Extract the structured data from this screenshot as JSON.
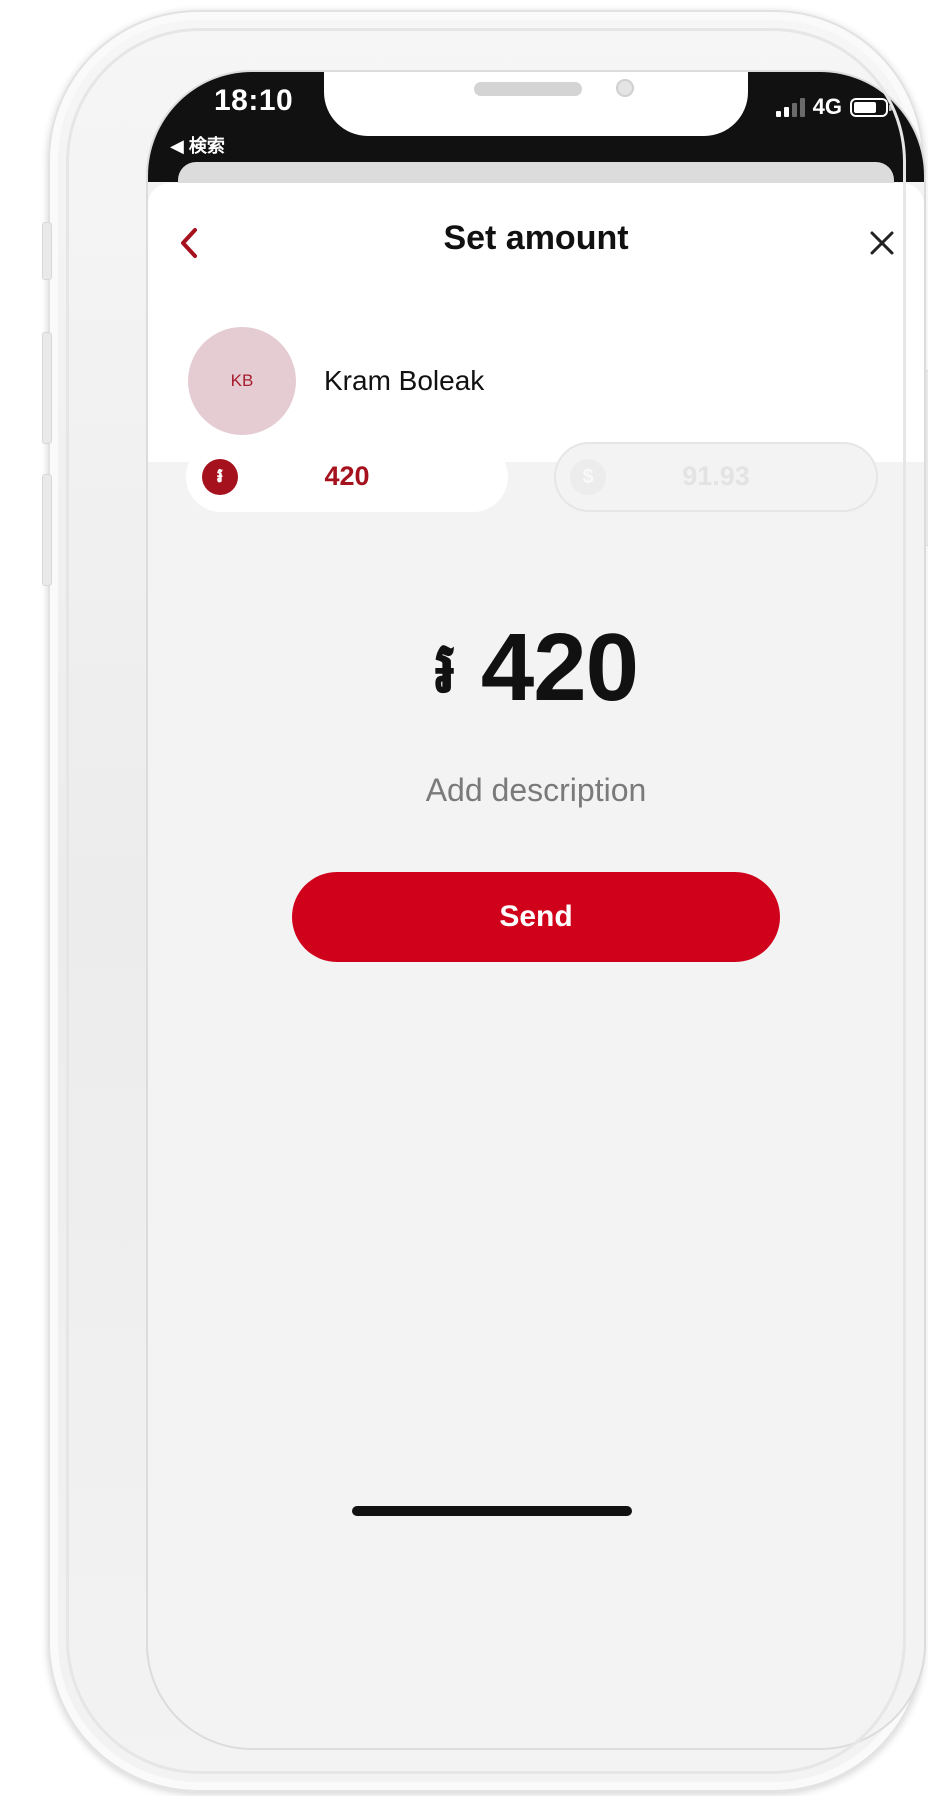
{
  "status_bar": {
    "time": "18:10",
    "back_link": "◀ 検索",
    "network": "4G",
    "icons": [
      "signal-icon",
      "battery-icon"
    ]
  },
  "header": {
    "title": "Set amount",
    "back_icon": "chevron-left-icon",
    "close_icon": "close-icon"
  },
  "recipient": {
    "initials": "KB",
    "name": "Kram Boleak"
  },
  "currency_toggle": {
    "riel": {
      "symbol": "៛",
      "value": "420",
      "selected": true
    },
    "usd": {
      "symbol": "$",
      "value": "91.93",
      "selected": false
    }
  },
  "amount": {
    "symbol": "៛",
    "value": "420"
  },
  "description": {
    "placeholder": "Add description"
  },
  "send_button": {
    "label": "Send"
  },
  "colors": {
    "accent": "#d0021b",
    "riel_accent": "#a5121e",
    "avatar_bg": "#e5ccd3",
    "background": "#f3f3f3",
    "status_bar": "#111111"
  }
}
